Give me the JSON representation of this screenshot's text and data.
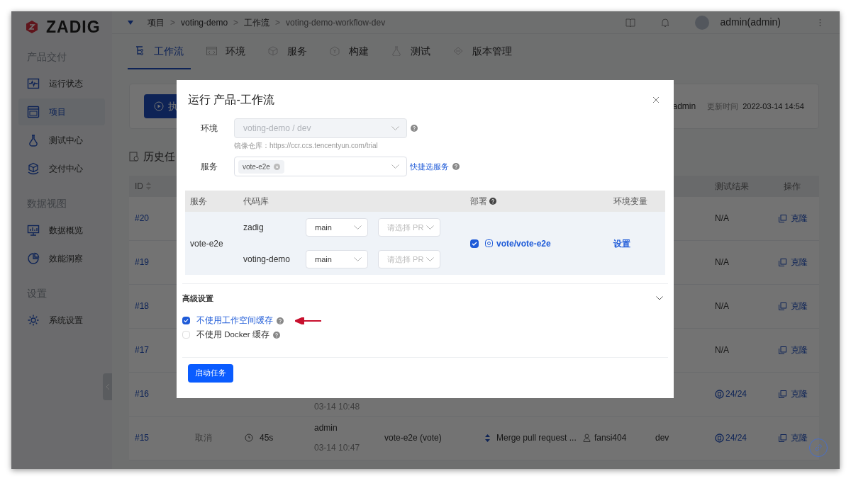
{
  "sidebar": {
    "logo": "ZADIG",
    "sections": [
      {
        "title": "产品交付",
        "items": [
          {
            "label": "运行状态",
            "selected": false
          },
          {
            "label": "项目",
            "selected": true
          },
          {
            "label": "测试中心",
            "selected": false
          },
          {
            "label": "交付中心",
            "selected": false
          }
        ]
      },
      {
        "title": "数据视图",
        "items": [
          {
            "label": "数据概览",
            "selected": false
          },
          {
            "label": "效能洞察",
            "selected": false
          }
        ]
      },
      {
        "title": "设置",
        "items": [
          {
            "label": "系统设置",
            "selected": false
          }
        ]
      }
    ]
  },
  "breadcrumb": [
    "项目",
    "voting-demo",
    "工作流",
    "voting-demo-workflow-dev"
  ],
  "breadcrumb_separator": ">",
  "user": "admin(admin)",
  "tabs": [
    {
      "label": "工作流",
      "selected": true
    },
    {
      "label": "环境",
      "selected": false
    },
    {
      "label": "服务",
      "selected": false
    },
    {
      "label": "构建",
      "selected": false
    },
    {
      "label": "测试",
      "selected": false
    },
    {
      "label": "版本管理",
      "selected": false
    }
  ],
  "summary": {
    "run_button": "执",
    "creator": "admin",
    "updated_label": "更新时间",
    "updated_value": "2022-03-14 14:54"
  },
  "history": {
    "title": "历史任",
    "header": {
      "id": "ID",
      "test_result": "测试结果",
      "action": "操作"
    },
    "rows": [
      {
        "id": "#20",
        "test_result": {
          "kind": "plain",
          "text": "N/A"
        },
        "action": "克隆"
      },
      {
        "id": "#19",
        "test_result": {
          "kind": "plain",
          "text": "N/A"
        },
        "action": "克隆"
      },
      {
        "id": "#18",
        "test_result": {
          "kind": "plain",
          "text": "N/A"
        },
        "action": "克隆"
      },
      {
        "id": "#17",
        "test_result": {
          "kind": "plain",
          "text": "N/A"
        },
        "action": "克隆"
      },
      {
        "id": "#16",
        "creator_time": "03-14 10:48",
        "test_result": {
          "kind": "count",
          "text": "24/24"
        },
        "action": "克隆"
      },
      {
        "id": "#15",
        "status": "取消",
        "duration": "45s",
        "creator": "admin",
        "creator_time": "03-14 10:47",
        "service": "vote-e2e (vote)",
        "commit": "Merge pull request ...",
        "author": "fansi404",
        "env": "dev",
        "test_result": {
          "kind": "count",
          "text": "24/24"
        },
        "action": "克隆"
      }
    ]
  },
  "modal": {
    "title": "运行 产品-工作流",
    "env": {
      "label": "环境",
      "value": "voting-demo / dev",
      "disabled": true,
      "hint": "镜像仓库：https://ccr.ccs.tencentyun.com/trial"
    },
    "service": {
      "label": "服务",
      "tags": [
        "vote-e2e"
      ],
      "quick_link": "快捷选服务"
    },
    "table": {
      "columns": [
        "服务",
        "代码库",
        "部署",
        "环境变量"
      ],
      "rows": [
        {
          "service": "vote-e2e",
          "repos": [
            {
              "name": "zadig",
              "branch": "main",
              "pr_placeholder": "请选择 PR"
            },
            {
              "name": "voting-demo",
              "branch": "main",
              "pr_placeholder": "请选择 PR"
            }
          ],
          "deploy": {
            "checked": true,
            "label": "vote/vote-e2e"
          },
          "env_vars": "设置"
        }
      ]
    },
    "advanced": {
      "title": "高级设置",
      "expanded": true,
      "options": [
        {
          "label": "不使用工作空间缓存",
          "checked": true
        },
        {
          "label": "不使用 Docker 缓存",
          "checked": false
        }
      ]
    },
    "submit": "启动任务"
  }
}
